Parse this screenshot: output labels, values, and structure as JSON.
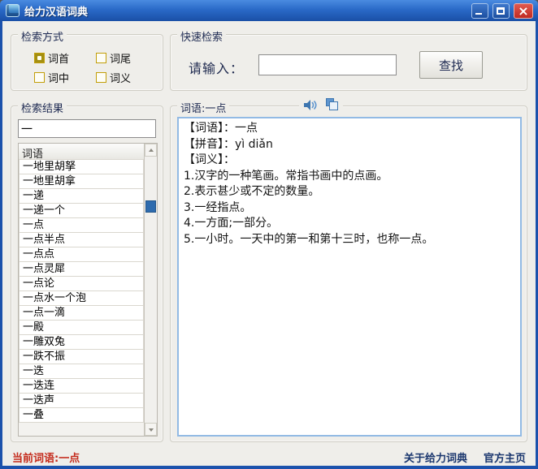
{
  "window": {
    "title": "给力汉语词典"
  },
  "search_mode": {
    "title": "检索方式",
    "options": [
      {
        "label": "词首",
        "checked": true
      },
      {
        "label": "词尾",
        "checked": false
      },
      {
        "label": "词中",
        "checked": false
      },
      {
        "label": "词义",
        "checked": false
      }
    ]
  },
  "quick_search": {
    "title": "快速检索",
    "input_label": "请输入：",
    "input_value": "",
    "find_button": "查找"
  },
  "results": {
    "title": "检索结果",
    "filter_value": "一",
    "column_header": "词语",
    "items": [
      "一地里胡拏",
      "一地里胡拿",
      "一递",
      "一递一个",
      "一点",
      "一点半点",
      "一点点",
      "一点灵犀",
      "一点论",
      "一点水一个泡",
      "一点一滴",
      "一殿",
      "一雕双兔",
      "一跌不振",
      "一迭",
      "一迭连",
      "一迭声",
      "一叠"
    ]
  },
  "definition": {
    "title": "词语:一点",
    "lines": [
      "【词语】：一点",
      "【拼音】：yì diǎn",
      "【词义】：",
      "1.汉字的一种笔画。常指书画中的点画。",
      "2.表示甚少或不定的数量。",
      "3.一经指点。",
      "4.一方面;一部分。",
      "5.一小时。一天中的第一和第十三时，也称一点。"
    ]
  },
  "status_bar": {
    "current_word": "当前词语:一点",
    "about_link": "关于给力词典",
    "homepage_link": "官方主页"
  },
  "colors": {
    "titlebar_blue": "#2A6AC8",
    "window_border": "#1C52AC",
    "close_red": "#C8352B",
    "checkbox_gold": "#C29E08",
    "scroll_thumb_blue": "#2E6BAE",
    "definition_border_blue": "#92BAE4",
    "current_word_red": "#C42B1C",
    "link_navy": "#1A366E",
    "background": "#EFEEEA"
  }
}
